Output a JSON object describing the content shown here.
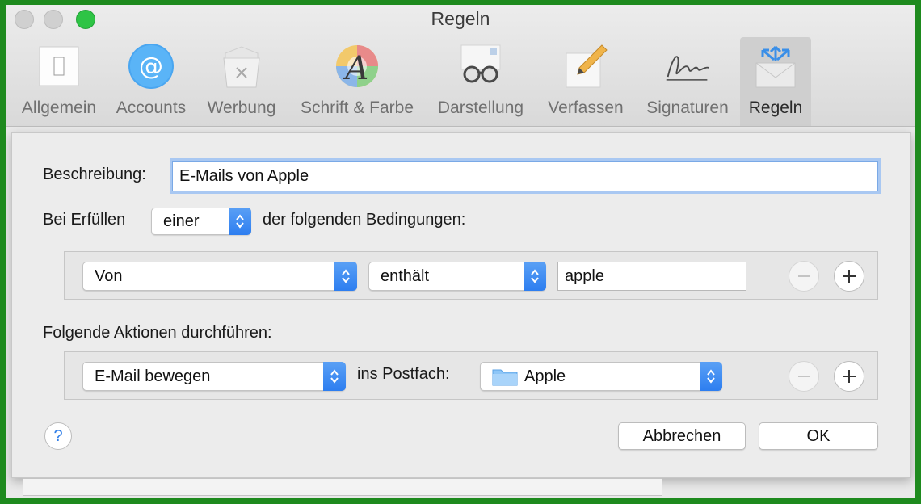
{
  "window": {
    "title": "Regeln"
  },
  "toolbar": {
    "items": [
      {
        "label": "Allgemein",
        "icon": "switch-icon"
      },
      {
        "label": "Accounts",
        "icon": "at-icon"
      },
      {
        "label": "Werbung",
        "icon": "junk-bin-icon"
      },
      {
        "label": "Schrift & Farbe",
        "icon": "font-color-icon"
      },
      {
        "label": "Darstellung",
        "icon": "glasses-icon"
      },
      {
        "label": "Verfassen",
        "icon": "pencil-icon"
      },
      {
        "label": "Signaturen",
        "icon": "signature-icon"
      },
      {
        "label": "Regeln",
        "icon": "rules-envelope-icon",
        "active": true
      }
    ]
  },
  "rule": {
    "description_label": "Beschreibung:",
    "description_value": "E-Mails von Apple",
    "match_prefix": "Bei Erfüllen",
    "match_value": "einer",
    "match_suffix": "der folgenden Bedingungen:",
    "condition": {
      "field": "Von",
      "operator": "enthält",
      "value": "apple"
    },
    "actions_label": "Folgende Aktionen durchführen:",
    "action": {
      "type": "E-Mail bewegen",
      "target_label": "ins Postfach:",
      "mailbox": "Apple"
    }
  },
  "buttons": {
    "cancel": "Abbrechen",
    "ok": "OK",
    "help": "?"
  },
  "colors": {
    "accent": "#2d7ef0",
    "focus_ring": "#a9c8f2",
    "frame": "#1e8a1e"
  }
}
